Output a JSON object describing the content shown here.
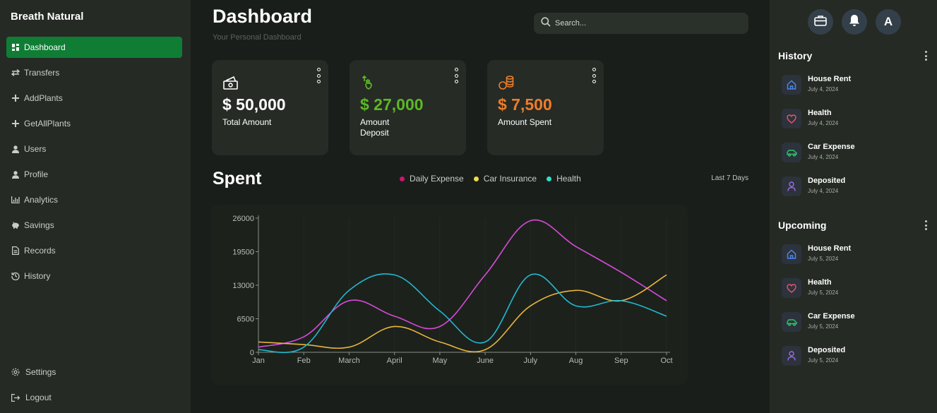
{
  "sidebar": {
    "brand": "Breath Natural",
    "items": [
      {
        "label": "Dashboard",
        "icon": "dashboard-icon",
        "active": true
      },
      {
        "label": "Transfers",
        "icon": "transfer-icon"
      },
      {
        "label": "AddPlants",
        "icon": "plus-icon"
      },
      {
        "label": "GetAllPlants",
        "icon": "plus-icon"
      },
      {
        "label": "Users",
        "icon": "user-icon"
      },
      {
        "label": "Profile",
        "icon": "user-icon"
      },
      {
        "label": "Analytics",
        "icon": "analytics-icon"
      },
      {
        "label": "Savings",
        "icon": "piggy-bank-icon"
      },
      {
        "label": "Records",
        "icon": "document-icon"
      },
      {
        "label": "History",
        "icon": "history-icon"
      }
    ],
    "bottom": [
      {
        "label": "Settings",
        "icon": "gear-icon"
      },
      {
        "label": "Logout",
        "icon": "logout-icon"
      }
    ]
  },
  "header": {
    "title": "Dashboard",
    "subtitle": "Your Personal Dashboard",
    "search_placeholder": "Search..."
  },
  "cards": [
    {
      "amount": "$ 50,000",
      "label": "Total Amount",
      "color": "#ffffff",
      "icon": "money-icon"
    },
    {
      "amount": "$ 27,000",
      "label": "Amount Deposit",
      "color": "#5cb824",
      "icon": "deposit-icon"
    },
    {
      "amount": "$ 7,500",
      "label": "Amount Spent",
      "color": "#ef7d28",
      "icon": "coins-icon"
    }
  ],
  "spent": {
    "title": "Spent",
    "range": "Last 7 Days",
    "legend": [
      {
        "name": "Daily Expense",
        "color": "#c8176e"
      },
      {
        "name": "Car Insurance",
        "color": "#f2dc45"
      },
      {
        "name": "Health",
        "color": "#2ee0c8"
      }
    ]
  },
  "chart_data": {
    "type": "line",
    "categories": [
      "Jan",
      "Feb",
      "March",
      "April",
      "May",
      "June",
      "July",
      "Aug",
      "Sep",
      "Oct"
    ],
    "yticks": [
      "0",
      "6500",
      "13000",
      "19500",
      "26000"
    ],
    "ylim": [
      0,
      26000
    ],
    "grid": true,
    "series": [
      {
        "name": "Daily Expense",
        "color": "#d74bd8",
        "values": [
          1000,
          3000,
          10000,
          7000,
          5000,
          15000,
          25500,
          20500,
          15500,
          10000
        ]
      },
      {
        "name": "Car Insurance",
        "color": "#e8b53a",
        "values": [
          2000,
          1500,
          1000,
          5000,
          2000,
          500,
          9000,
          12000,
          10000,
          15000
        ]
      },
      {
        "name": "Health",
        "color": "#22b8cf",
        "values": [
          500,
          1000,
          12000,
          15000,
          8000,
          2000,
          15000,
          9000,
          10000,
          7000
        ]
      }
    ]
  },
  "right_panel": {
    "avatar_letter": "A",
    "history_title": "History",
    "history": [
      {
        "title": "House Rent",
        "date": "July 4, 2024",
        "icon": "home-icon",
        "color": "#4a86e8"
      },
      {
        "title": "Health",
        "date": "July 4, 2024",
        "icon": "heart-icon",
        "color": "#e8536a"
      },
      {
        "title": "Car Expense",
        "date": "July 4, 2024",
        "icon": "car-icon",
        "color": "#2fc46b"
      },
      {
        "title": "Deposited",
        "date": "July 4, 2024",
        "icon": "user-icon",
        "color": "#a06be0"
      }
    ],
    "upcoming_title": "Upcoming",
    "upcoming": [
      {
        "title": "House Rent",
        "date": "July 5, 2024",
        "icon": "home-icon",
        "color": "#4a86e8"
      },
      {
        "title": "Health",
        "date": "July 5, 2024",
        "icon": "heart-icon",
        "color": "#e8536a"
      },
      {
        "title": "Car Expense",
        "date": "July 5, 2024",
        "icon": "car-icon",
        "color": "#2fc46b"
      },
      {
        "title": "Deposited",
        "date": "July 5, 2024",
        "icon": "user-icon",
        "color": "#a06be0"
      }
    ]
  }
}
